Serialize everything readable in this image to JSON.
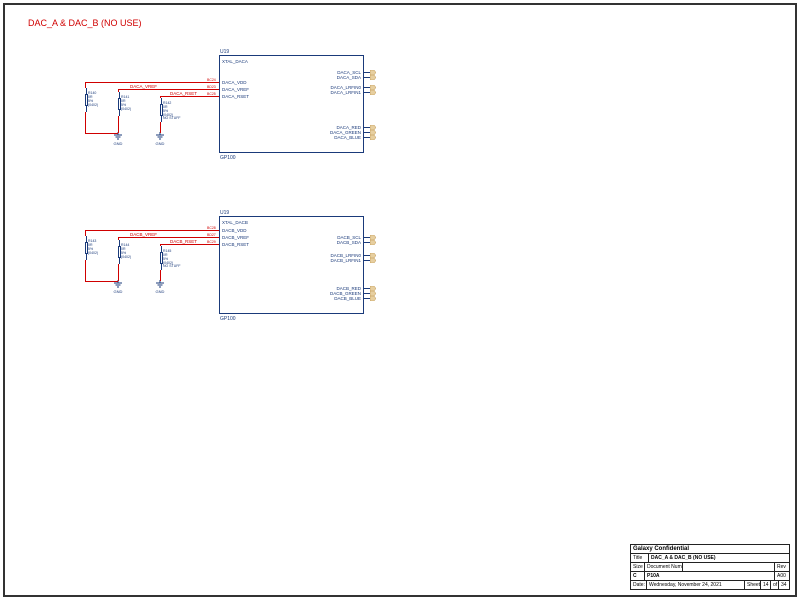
{
  "title": "DAC_A & DAC_B (NO USE)",
  "block_a": {
    "ref": "U19",
    "part": "GP100",
    "pins_left": [
      {
        "label": "XTAL_DACA",
        "num": ""
      },
      {
        "label": "DACA_VDD",
        "num": "BC24"
      },
      {
        "label": "DACA_VREF",
        "num": "BD23"
      },
      {
        "label": "DACA_RSET",
        "num": "BC25"
      }
    ],
    "pins_right": [
      {
        "label": "DACA_SCL",
        "num": ""
      },
      {
        "label": "DACA_SDA",
        "num": ""
      },
      {
        "label": "DACA_LRFIN0",
        "num": ""
      },
      {
        "label": "DACA_LRFIN1",
        "num": ""
      },
      {
        "label": "DACA_RED",
        "num": ""
      },
      {
        "label": "DACA_GREEN",
        "num": ""
      },
      {
        "label": "DACA_BLUE",
        "num": ""
      }
    ]
  },
  "block_b": {
    "ref": "U19",
    "part": "GP100",
    "pins_left": [
      {
        "label": "XTAL_DACB",
        "num": ""
      },
      {
        "label": "DACB_VDD",
        "num": "BC28"
      },
      {
        "label": "DACB_VREF",
        "num": "BD27"
      },
      {
        "label": "DACB_RSET",
        "num": "BC29"
      }
    ],
    "pins_right": [
      {
        "label": "DACB_SCL",
        "num": ""
      },
      {
        "label": "DACB_SDA",
        "num": ""
      },
      {
        "label": "DACB_LRFIN0",
        "num": ""
      },
      {
        "label": "DACB_LRFIN1",
        "num": ""
      },
      {
        "label": "DACB_RED",
        "num": ""
      },
      {
        "label": "DACB_GREEN",
        "num": ""
      },
      {
        "label": "DACB_BLUE",
        "num": ""
      }
    ]
  },
  "nets_a": {
    "vdd": "",
    "vref": "DACA_VREF",
    "rset": "DACA_RSET"
  },
  "nets_b": {
    "vdd": "",
    "vref": "DACB_VREF",
    "rset": "DACB_RSET"
  },
  "resistors_a": [
    {
      "ref": "R140",
      "val": "0R",
      "tol": "5%",
      "pkg": "(0402)"
    },
    {
      "ref": "R141",
      "val": "0R",
      "tol": "5%",
      "pkg": "(0402)"
    },
    {
      "ref": "R142",
      "val": "0R",
      "tol": "5%",
      "pkg": "(0402)",
      "note": "NO STUFF"
    }
  ],
  "resistors_b": [
    {
      "ref": "R143",
      "val": "0R",
      "tol": "5%",
      "pkg": "(0402)"
    },
    {
      "ref": "R144",
      "val": "0R",
      "tol": "5%",
      "pkg": "(0402)"
    },
    {
      "ref": "R145",
      "val": "0R",
      "tol": "5%",
      "pkg": "(0402)",
      "note": "NO STUFF"
    }
  ],
  "gnd": "GND",
  "titleblock": {
    "company": "Galaxy Confidential",
    "title_label": "Title",
    "title": "DAC_A & DAC_B (NO USE)",
    "size_label": "Size",
    "size": "C",
    "docnum_label": "Document Number",
    "docnum": "P10A",
    "rev_label": "Rev",
    "rev": "A00",
    "date_label": "Date:",
    "date": "Wednesday, November 24, 2021",
    "sheet_label": "Sheet",
    "sheet": "14",
    "of_label": "of",
    "of": "34"
  }
}
